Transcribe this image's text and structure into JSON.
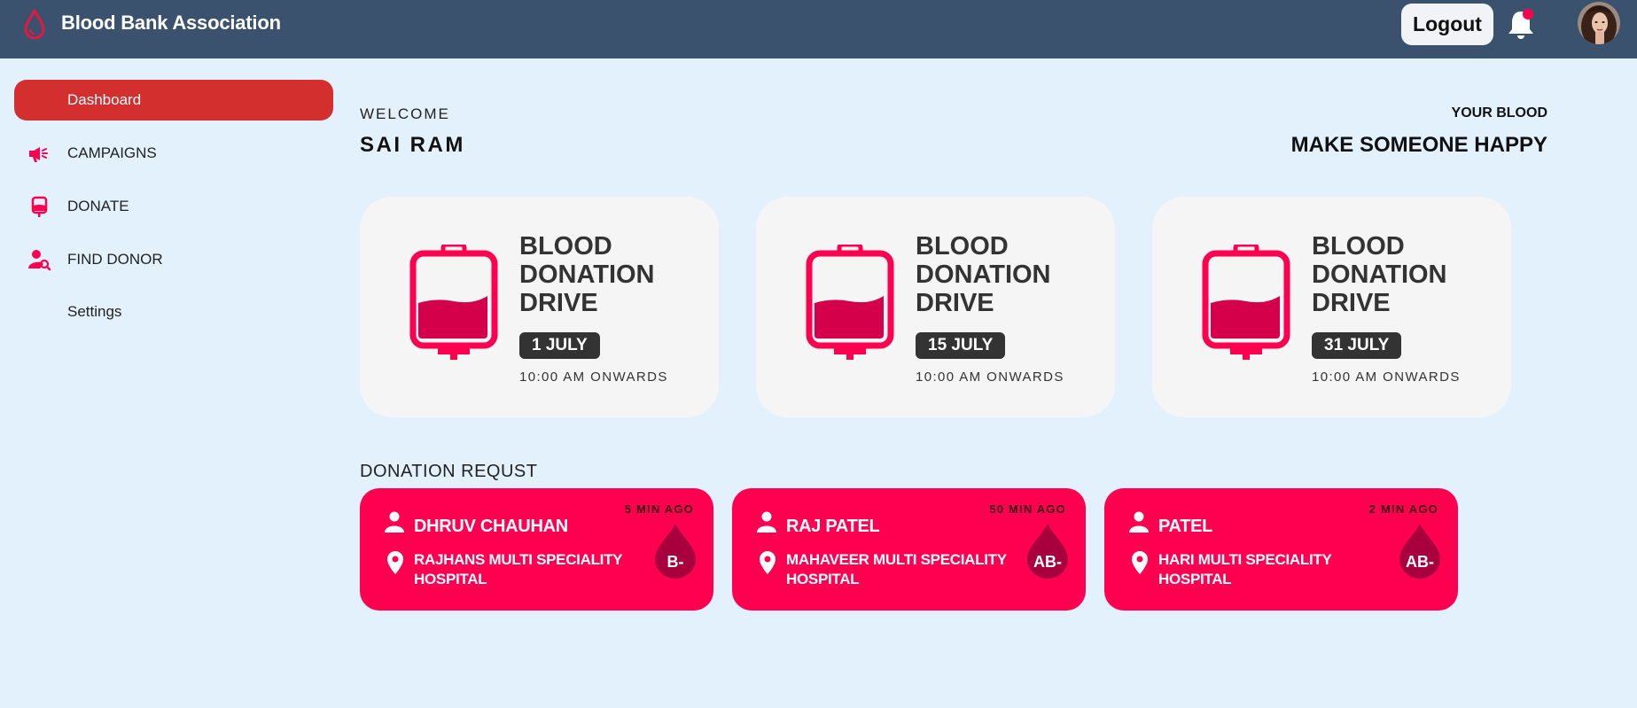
{
  "header": {
    "title": "Blood Bank Association",
    "logout_label": "Logout",
    "brand_icon": "blood-drop-icon",
    "notification_icon": "bell-icon"
  },
  "sidebar": {
    "items": [
      {
        "label": "Dashboard",
        "icon": "",
        "active": true
      },
      {
        "label": "CAMPAIGNS",
        "icon": "megaphone-icon"
      },
      {
        "label": "DONATE",
        "icon": "blood-bag-icon"
      },
      {
        "label": "FIND DONOR",
        "icon": "user-search-icon"
      },
      {
        "label": "Settings",
        "icon": ""
      }
    ]
  },
  "welcome": {
    "greeting": "WELCOME",
    "name": "SAI RAM",
    "tagline_top": "YOUR BLOOD",
    "tagline_main": "MAKE SOMEONE HAPPY"
  },
  "drives": [
    {
      "title": "BLOOD DONATION DRIVE",
      "date": "1 JULY",
      "time": "10:00 AM ONWARDS"
    },
    {
      "title": "BLOOD DONATION DRIVE",
      "date": "15 JULY",
      "time": "10:00 AM ONWARDS"
    },
    {
      "title": "BLOOD DONATION DRIVE",
      "date": "31 JULY",
      "time": "10:00 AM ONWARDS"
    }
  ],
  "requests": {
    "heading": "DONATION REQUST",
    "items": [
      {
        "ago": "5 MIN AGO",
        "name": "DHRUV CHAUHAN",
        "hospital": "RAJHANS MULTI SPECIALITY HOSPITAL",
        "blood_group": "B-"
      },
      {
        "ago": "50 MIN AGO",
        "name": "RAJ PATEL",
        "hospital": "MAHAVEER MULTI SPECIALITY HOSPITAL",
        "blood_group": "AB-"
      },
      {
        "ago": "2 MIN AGO",
        "name": "PATEL",
        "hospital": "HARI MULTI SPECIALITY HOSPITAL",
        "blood_group": "AB-"
      }
    ]
  },
  "colors": {
    "topbar": "#3b526e",
    "background": "#e3f1fc",
    "active_nav": "#d32f2f",
    "accent": "#ff0051",
    "drop_dark": "#a8003c"
  }
}
